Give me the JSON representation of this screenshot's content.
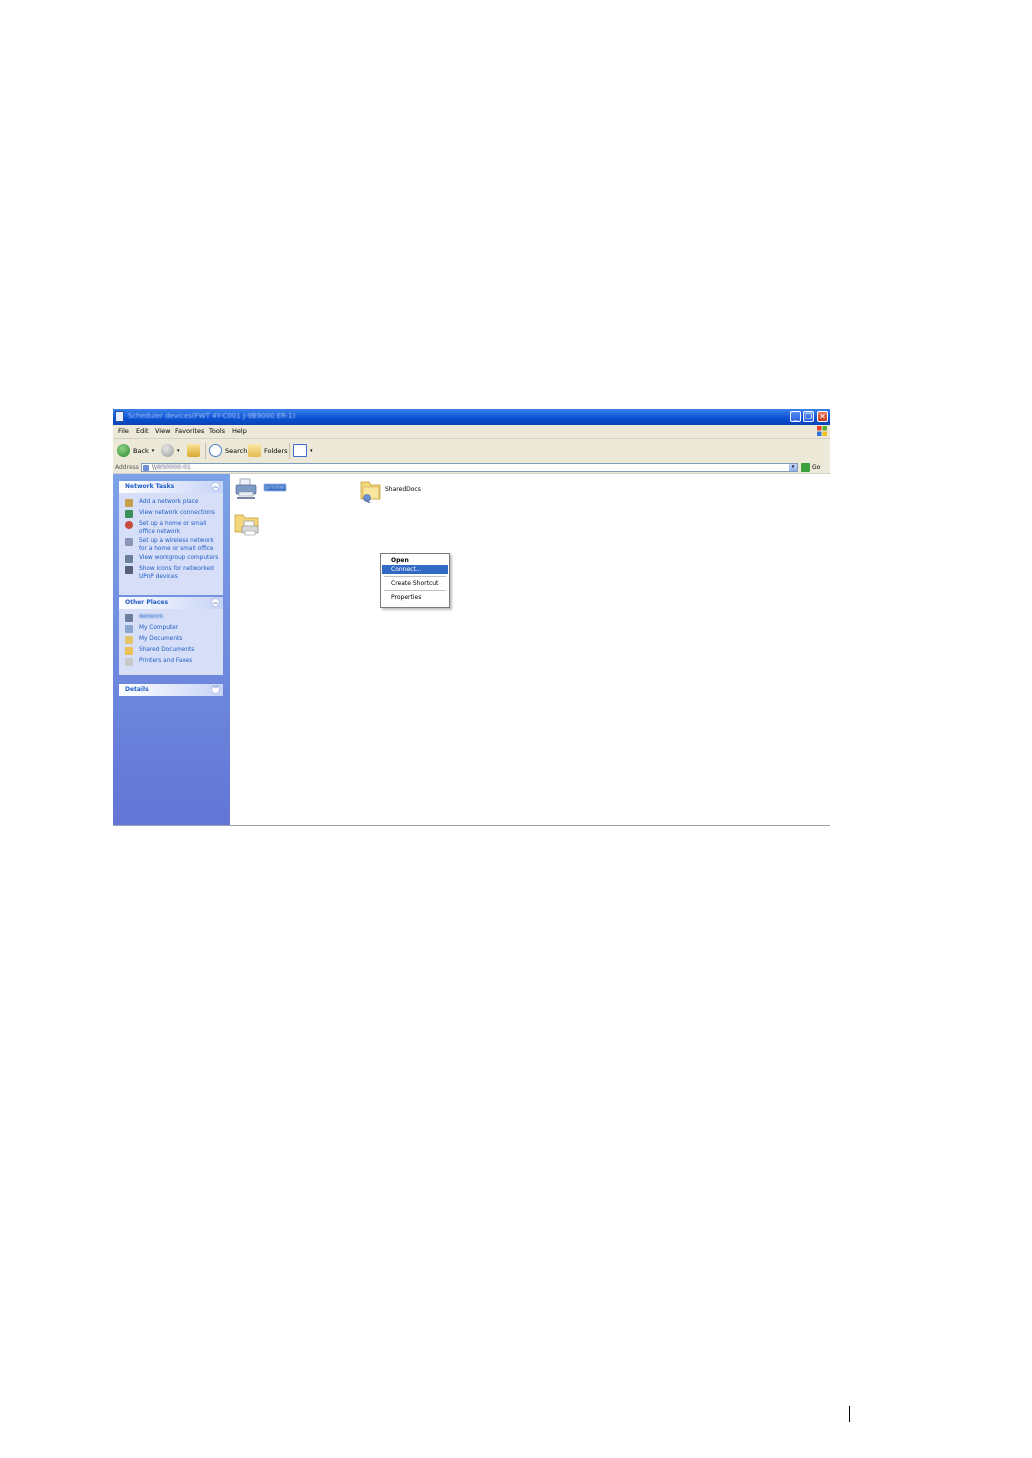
{
  "window": {
    "title": "Scheduler devices(FWT 4Y-C001 J-9B9000 ER-1)",
    "controls": {
      "minimize": "_",
      "maximize": "❐",
      "close": "✕"
    }
  },
  "menubar": {
    "items": [
      "File",
      "Edit",
      "View",
      "Favorites",
      "Tools",
      "Help"
    ]
  },
  "toolbar": {
    "back_label": "Back",
    "search_label": "Search",
    "folders_label": "Folders"
  },
  "address": {
    "label": "Address",
    "value_prefix": "\\\\",
    "value_blurred": "WS0000-01",
    "go_label": "Go"
  },
  "network_tasks": {
    "title": "Network Tasks",
    "items": [
      "Add a network place",
      "View network connections",
      "Set up a home or small\noffice network",
      "Set up a wireless network\nfor a home or small office",
      "View workgroup computers",
      "Show icons for networked\nUPnP devices"
    ]
  },
  "other_places": {
    "title": "Other Places",
    "items": [
      "Network",
      "My Computer",
      "My Documents",
      "Shared Documents",
      "Printers and Faxes"
    ]
  },
  "details": {
    "title": "Details"
  },
  "content": {
    "selected_icon_label": "printer",
    "shared_label": "SharedDocs"
  },
  "context_menu": {
    "open": "Open",
    "connect": "Connect...",
    "create_shortcut": "Create Shortcut",
    "properties": "Properties"
  },
  "colors": {
    "titlebar": "#0a4fd1",
    "taskpane": "#6375d6",
    "highlight": "#316ac5",
    "link": "#215dc6"
  }
}
